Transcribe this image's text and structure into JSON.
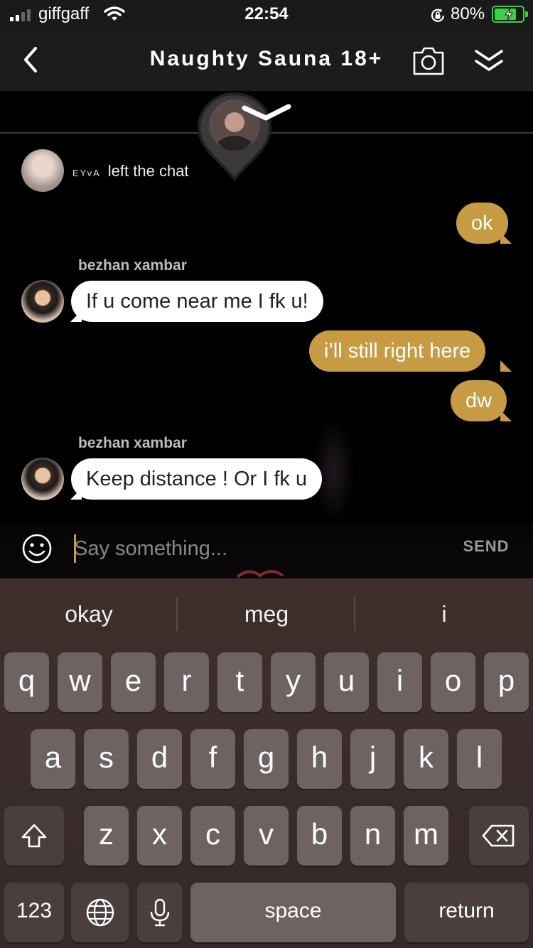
{
  "status_bar": {
    "carrier": "giffgaff",
    "time": "22:54",
    "battery_percent": "80%",
    "battery_level": 0.8,
    "signal_bars": 4,
    "signal_active": 2
  },
  "header": {
    "title": "Naughty Sauna 18+",
    "back_icon": "chevron-left-icon",
    "camera_icon": "camera-icon",
    "collapse_icon": "double-chevron-down-icon"
  },
  "chat": {
    "system_event": {
      "user": "EYvA",
      "text": "left the chat"
    },
    "messages": [
      {
        "direction": "out",
        "text": "ok"
      },
      {
        "direction": "in",
        "sender": "bezhan xambar",
        "text": "If u come near me I fk u!"
      },
      {
        "direction": "out",
        "text": "i’ll still right here"
      },
      {
        "direction": "out",
        "text": "dw"
      },
      {
        "direction": "in",
        "sender": "bezhan xambar",
        "text": "Keep distance ! Or I fk u"
      }
    ]
  },
  "input": {
    "placeholder": "Say something...",
    "value": "",
    "send_label": "SEND",
    "emoji_icon": "smiley-icon"
  },
  "keyboard": {
    "suggestions": [
      "okay",
      "meg",
      "i"
    ],
    "row1": [
      "q",
      "w",
      "e",
      "r",
      "t",
      "y",
      "u",
      "i",
      "o",
      "p"
    ],
    "row2": [
      "a",
      "s",
      "d",
      "f",
      "g",
      "h",
      "j",
      "k",
      "l"
    ],
    "row3": [
      "z",
      "x",
      "c",
      "v",
      "b",
      "n",
      "m"
    ],
    "numbers_label": "123",
    "space_label": "space",
    "return_label": "return",
    "shift_icon": "shift-icon",
    "delete_icon": "backspace-icon",
    "globe_icon": "globe-icon",
    "mic_icon": "microphone-icon"
  },
  "colors": {
    "outgoing_bubble": "#c79b43",
    "incoming_bubble": "#ffffff",
    "battery": "#3ecf4a"
  }
}
